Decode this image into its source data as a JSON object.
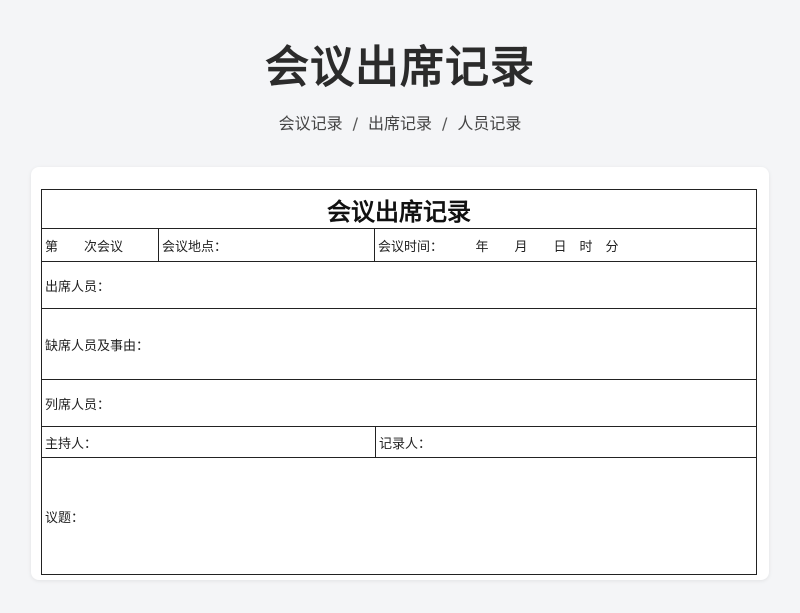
{
  "header": {
    "title": "会议出席记录",
    "breadcrumb": [
      "会议记录",
      "出席记录",
      "人员记录"
    ]
  },
  "form": {
    "title": "会议出席记录",
    "meeting_number": "第　　次会议",
    "meeting_location": "会议地点：",
    "meeting_time": "会议时间：　　　年　　月　　日　时　分",
    "attendees": "出席人员：",
    "absentees": "缺席人员及事由：",
    "observers": "列席人员：",
    "host": "主持人：",
    "recorder": "记录人：",
    "topic": "议题："
  }
}
